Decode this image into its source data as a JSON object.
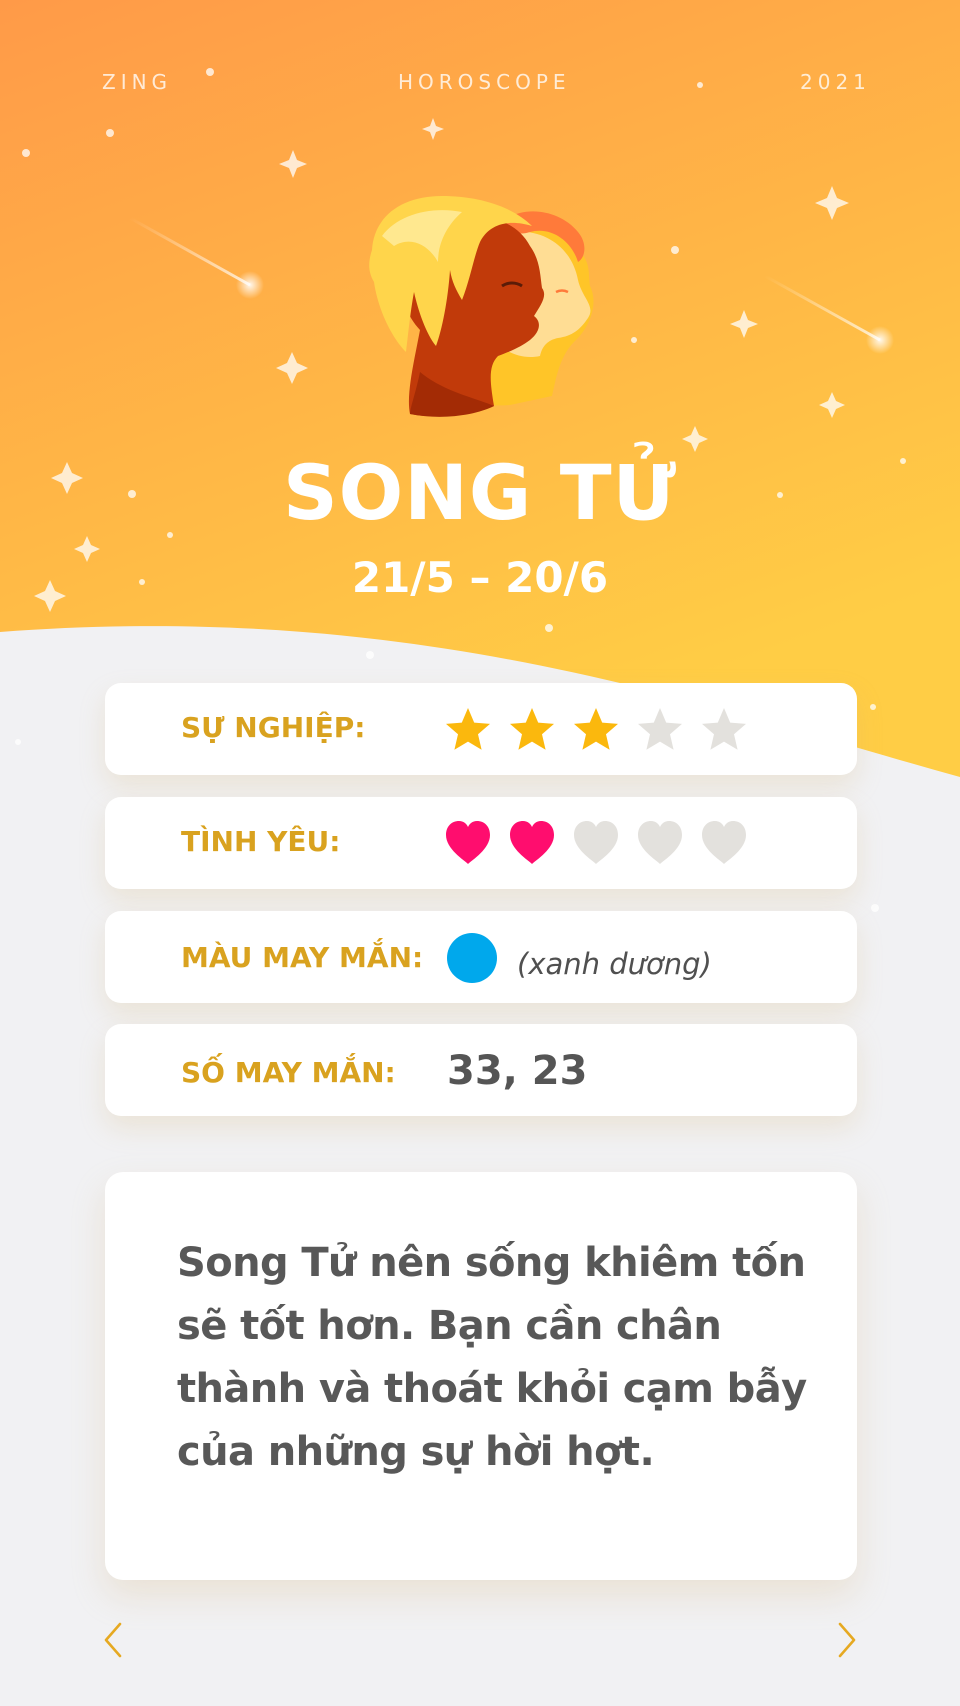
{
  "header": {
    "brand": "ZING",
    "section": "HOROSCOPE",
    "year": "2021"
  },
  "sign": {
    "name": "SONG TỬ",
    "dates": "21/5 – 20/6",
    "illustration": "gemini-twins-profile-icon"
  },
  "stats": {
    "career": {
      "label": "SỰ NGHIỆP:",
      "rating": 3,
      "max": 5,
      "icon": "star-icon"
    },
    "love": {
      "label": "TÌNH YÊU:",
      "rating": 2,
      "max": 5,
      "icon": "heart-icon"
    },
    "lucky_color": {
      "label": "MÀU MAY MẮN:",
      "color_name": "(xanh dương)",
      "swatch": "#00a8ec"
    },
    "lucky_numbers": {
      "label": "SỐ MAY MẮN:",
      "value": "33, 23"
    }
  },
  "advice": "Song Tử nên sống khiêm tốn sẽ tốt hơn. Bạn cần chân thành và thoát khỏi cạm bẫy của những sự hời hợt.",
  "navigation": {
    "prev_icon": "chevron-left-icon",
    "next_icon": "chevron-right-icon"
  },
  "colors": {
    "header_gradient_top": "#ff9c4a",
    "header_gradient_bottom": "#ffcc45",
    "accent_gold": "#d9a21f",
    "star_filled": "#fbb80d",
    "heart_filled": "#ff0d6e",
    "inactive": "#e3e1dd",
    "background": "#f1f1f3"
  }
}
